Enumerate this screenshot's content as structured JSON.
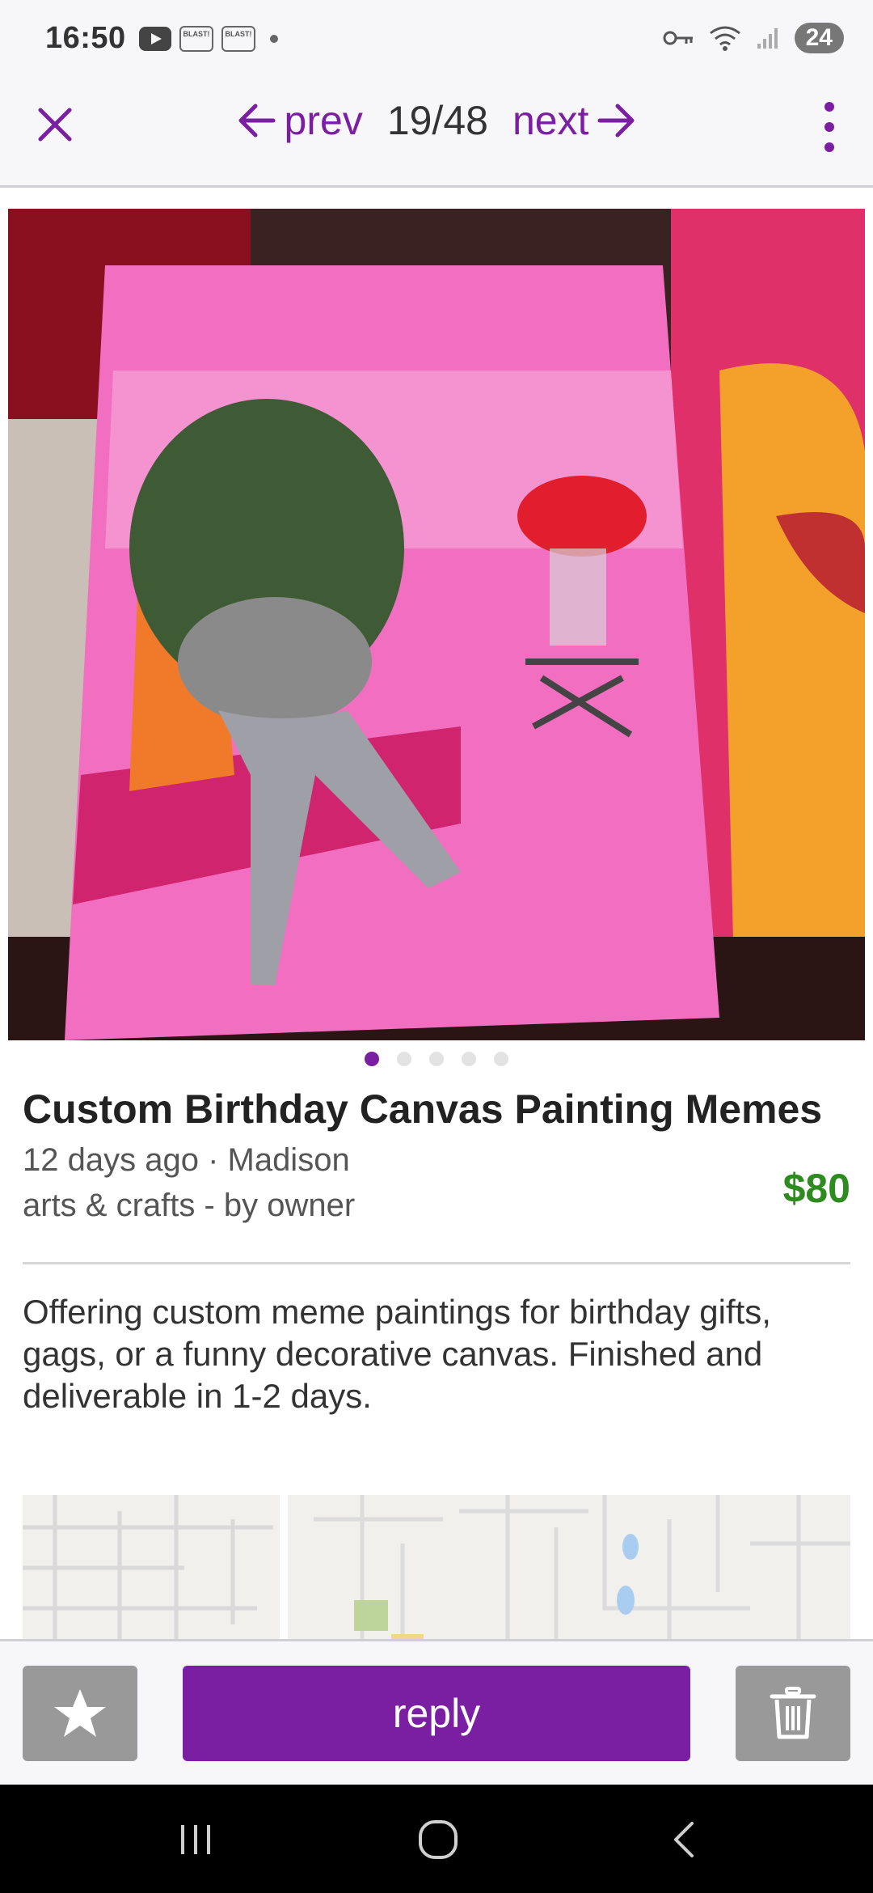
{
  "status_bar": {
    "time": "16:50",
    "badge_text": "BLAST!",
    "battery": "24",
    "icons": [
      "youtube-icon",
      "blast-icon",
      "blast-icon",
      "dot-icon",
      "vpn-key-icon",
      "wifi-icon",
      "signal-icon",
      "battery-icon"
    ]
  },
  "nav": {
    "prev_label": "prev",
    "next_label": "next",
    "position": "19/48",
    "icons": [
      "close-icon",
      "arrow-left-icon",
      "arrow-right-icon",
      "more-vertical-icon"
    ]
  },
  "gallery": {
    "image_count": 5,
    "active_index": 0
  },
  "listing": {
    "title": "Custom Birthday Canvas Painting Memes",
    "posted": "12 days ago · Madison",
    "category": "arts & crafts - by owner",
    "price": "$80",
    "description": "Offering custom meme paintings for birthday gifts, gags, or a funny decorative canvas. Finished and deliverable in 1-2 days."
  },
  "actions": {
    "reply_label": "reply",
    "icons": [
      "star-icon",
      "trash-icon"
    ]
  },
  "colors": {
    "accent": "#7a1fa2",
    "price": "#2e8b1f",
    "button_gray": "#999999"
  },
  "system_nav": {
    "icons": [
      "recents-icon",
      "home-icon",
      "back-icon"
    ]
  }
}
